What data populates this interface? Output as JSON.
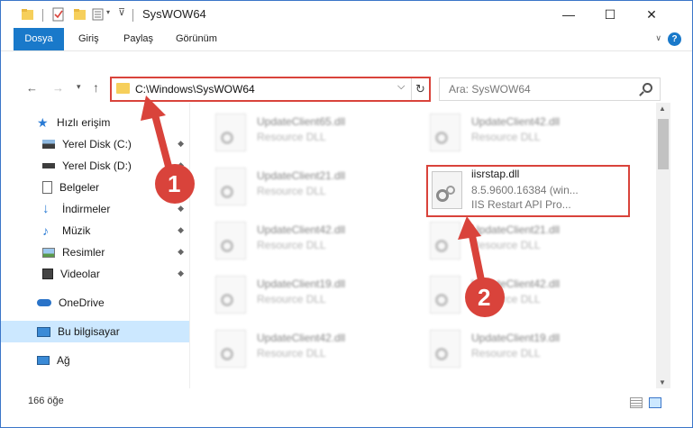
{
  "window": {
    "title": "SysWOW64",
    "minimize": "—",
    "maximize": "☐",
    "close": "✕"
  },
  "ribbon": {
    "tabs": [
      "Dosya",
      "Giriş",
      "Paylaş",
      "Görünüm"
    ],
    "help": "?"
  },
  "nav": {
    "back": "←",
    "forward": "→",
    "recent": "▾",
    "up": "↑",
    "address": "C:\\Windows\\SysWOW64",
    "address_dropdown": "⌵",
    "refresh": "↻",
    "search_placeholder": "Ara: SysWOW64"
  },
  "sidebar": {
    "quick_access": "Hızlı erişim",
    "items": [
      {
        "label": "Yerel Disk (C:)",
        "pinned": true
      },
      {
        "label": "Yerel Disk (D:)",
        "pinned": true
      },
      {
        "label": "Belgeler",
        "pinned": true
      },
      {
        "label": "İndirmeler",
        "pinned": true
      },
      {
        "label": "Müzik",
        "pinned": true
      },
      {
        "label": "Resimler",
        "pinned": true
      },
      {
        "label": "Videolar",
        "pinned": true
      }
    ],
    "onedrive": "OneDrive",
    "this_pc": "Bu bilgisayar",
    "network": "Ağ",
    "pin_glyph": "📌"
  },
  "files": [
    {
      "name": "UpdateClient65.dll",
      "sub": "Resource DLL"
    },
    {
      "name": "UpdateClient42.dll",
      "sub": "Resource DLL"
    },
    {
      "name": "UpdateClient21.dll",
      "sub": "Resource DLL"
    },
    {
      "name": "iisrstap.dll",
      "sub": "8.5.9600.16384 (win...",
      "sub2": "IIS Restart API Pro..."
    },
    {
      "name": "UpdateClient42.dll",
      "sub": "Resource DLL"
    },
    {
      "name": "UpdateClient21.dll",
      "sub": "Resource DLL"
    },
    {
      "name": "UpdateClient19.dll",
      "sub": "Resource DLL"
    },
    {
      "name": "UpdateClient42.dll",
      "sub": "Resource DLL"
    },
    {
      "name": "UpdateClient42.dll",
      "sub": "Resource DLL"
    },
    {
      "name": "UpdateClient19.dll",
      "sub": "Resource DLL"
    }
  ],
  "status": {
    "count": "166 öğe"
  },
  "annotations": {
    "step1": "1",
    "step2": "2",
    "color": "#d9433b"
  }
}
